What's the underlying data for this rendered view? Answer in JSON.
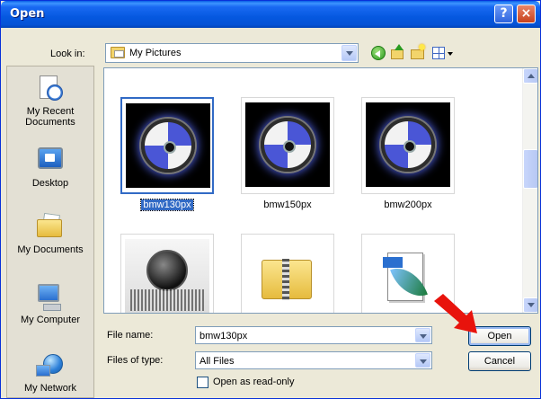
{
  "window": {
    "title": "Open",
    "help_label": "?",
    "close_label": "×"
  },
  "toolbar": {
    "look_in_label": "Look in:",
    "look_in_value": "My Pictures",
    "icons": [
      "back-icon",
      "up-folder-icon",
      "new-folder-icon",
      "views-menu-icon"
    ]
  },
  "places": [
    {
      "label": "My Recent Documents",
      "icon": "recent-documents-icon"
    },
    {
      "label": "Desktop",
      "icon": "desktop-icon"
    },
    {
      "label": "My Documents",
      "icon": "my-documents-icon"
    },
    {
      "label": "My Computer",
      "icon": "my-computer-icon"
    },
    {
      "label": "My Network",
      "icon": "my-network-icon"
    }
  ],
  "files": [
    {
      "label": "bmw130px",
      "selected": true
    },
    {
      "label": "bmw150px",
      "selected": false
    },
    {
      "label": "bmw200px",
      "selected": false
    },
    {
      "label": "",
      "selected": false
    },
    {
      "label": "",
      "selected": false
    },
    {
      "label": "",
      "selected": false
    }
  ],
  "form": {
    "file_name_label": "File name:",
    "file_name_value": "bmw130px",
    "file_type_label": "Files of type:",
    "file_type_value": "All Files",
    "readonly_label": "Open as read-only",
    "readonly_checked": false
  },
  "buttons": {
    "open": "Open",
    "cancel": "Cancel"
  },
  "colors": {
    "titlebar": "#0558e0",
    "selection": "#316ac5",
    "annotation_arrow": "#e8130c"
  }
}
